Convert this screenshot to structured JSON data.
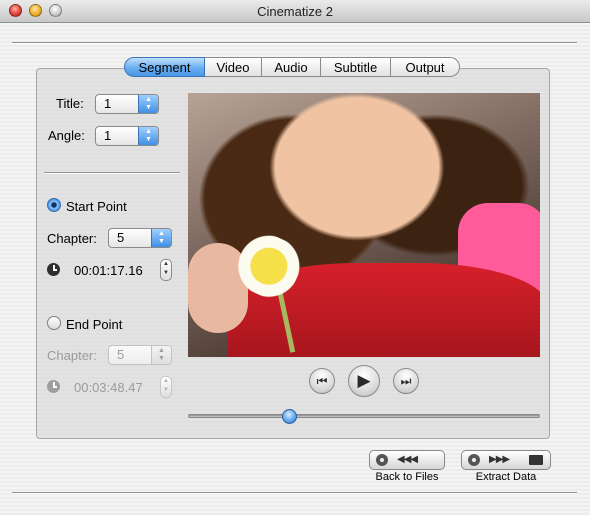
{
  "window": {
    "title": "Cinematize 2"
  },
  "tabs": [
    {
      "label": "Segment",
      "active": true
    },
    {
      "label": "Video",
      "active": false
    },
    {
      "label": "Audio",
      "active": false
    },
    {
      "label": "Subtitle",
      "active": false
    },
    {
      "label": "Output",
      "active": false
    }
  ],
  "segment": {
    "title_label": "Title:",
    "title_value": "1",
    "angle_label": "Angle:",
    "angle_value": "1",
    "start": {
      "radio_label": "Start Point",
      "selected": true,
      "chapter_label": "Chapter:",
      "chapter_value": "5",
      "time": "00:01:17.16"
    },
    "end": {
      "radio_label": "End Point",
      "selected": false,
      "chapter_label": "Chapter:",
      "chapter_value": "5",
      "time": "00:03:48.47"
    }
  },
  "player": {
    "scrubber_position_fraction": 0.28
  },
  "actions": {
    "back_label": "Back to Files",
    "extract_label": "Extract Data"
  },
  "colors": {
    "accent": "#4b97e6"
  }
}
